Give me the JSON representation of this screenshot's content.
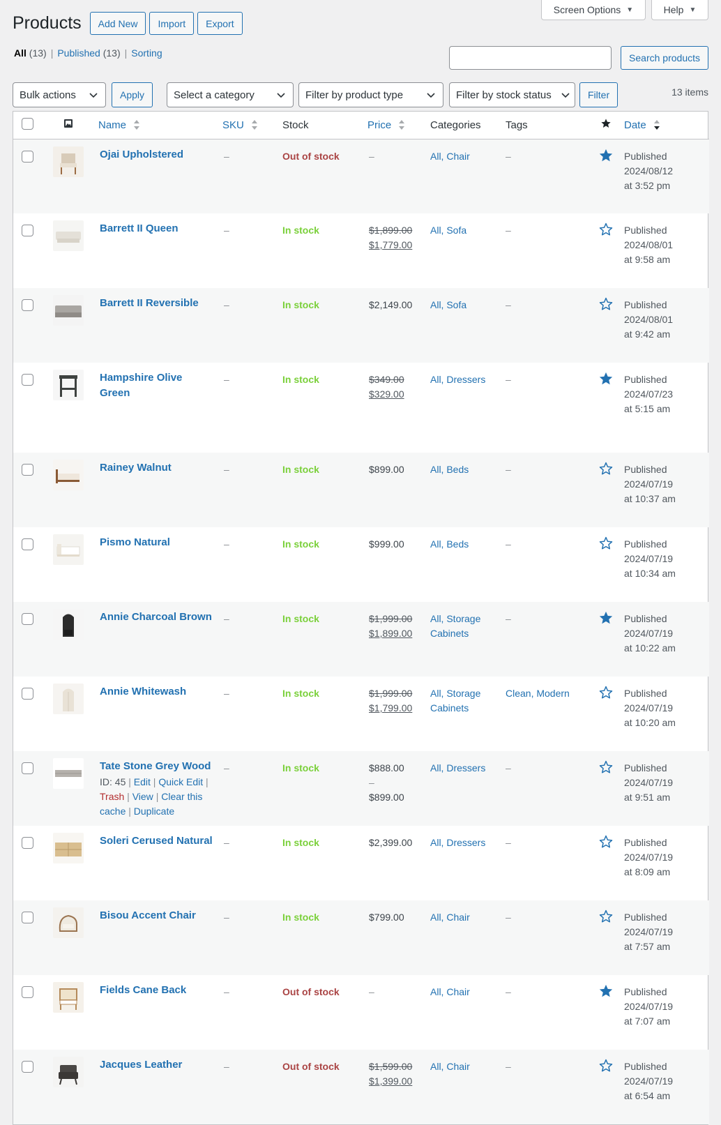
{
  "header": {
    "title": "Products",
    "actions": [
      "Add New",
      "Import",
      "Export"
    ],
    "screen_options": "Screen Options",
    "help": "Help"
  },
  "views": [
    {
      "label": "All",
      "count": "(13)",
      "current": true
    },
    {
      "label": "Published",
      "count": "(13)"
    },
    {
      "label": "Sorting",
      "count": ""
    }
  ],
  "search": {
    "value": "",
    "button": "Search products"
  },
  "tablenav": {
    "bulk_actions": "Bulk actions",
    "apply": "Apply",
    "category": "Select a category",
    "product_type": "Filter by product type",
    "stock_status": "Filter by stock status",
    "filter": "Filter",
    "items": "13 items"
  },
  "columns": {
    "name": "Name",
    "sku": "SKU",
    "stock": "Stock",
    "price": "Price",
    "categories": "Categories",
    "tags": "Tags",
    "date": "Date"
  },
  "colors": {
    "accent": "#2271b1",
    "in_stock": "#7ad03a",
    "out_of_stock": "#aa4444"
  },
  "rows": [
    {
      "name": "Ojai Upholstered",
      "sku": "–",
      "stock": "Out of stock",
      "in": false,
      "price_regular": "–",
      "price_sale": "",
      "categories": "All, Chair",
      "tags": "–",
      "featured": true,
      "status": "Published",
      "date": "2024/08/12",
      "time": "at 3:52 pm",
      "thumb": "chair-light"
    },
    {
      "name": "Barrett II Queen",
      "sku": "–",
      "stock": "In stock",
      "in": true,
      "price_regular": "$1,899.00",
      "price_sale": "$1,779.00",
      "categories": "All, Sofa",
      "tags": "–",
      "featured": false,
      "status": "Published",
      "date": "2024/08/01",
      "time": "at 9:58 am",
      "thumb": "sofa-cream"
    },
    {
      "name": "Barrett II Reversible",
      "sku": "–",
      "stock": "In stock",
      "in": true,
      "price_regular": "$2,149.00",
      "price_sale": "",
      "categories": "All, Sofa",
      "tags": "–",
      "featured": false,
      "status": "Published",
      "date": "2024/08/01",
      "time": "at 9:42 am",
      "thumb": "sofa-grey"
    },
    {
      "name": "Hampshire Olive Green",
      "sku": "–",
      "stock": "In stock",
      "in": true,
      "price_regular": "$349.00",
      "price_sale": "$329.00",
      "categories": "All, Dressers",
      "tags": "–",
      "featured": true,
      "status": "Published",
      "date": "2024/07/23",
      "time": "at 5:15 am",
      "thumb": "table-dark"
    },
    {
      "name": "Rainey Walnut",
      "sku": "–",
      "stock": "In stock",
      "in": true,
      "price_regular": "$899.00",
      "price_sale": "",
      "categories": "All, Beds",
      "tags": "–",
      "featured": false,
      "status": "Published",
      "date": "2024/07/19",
      "time": "at 10:37 am",
      "thumb": "bed-walnut"
    },
    {
      "name": "Pismo Natural",
      "sku": "–",
      "stock": "In stock",
      "in": true,
      "price_regular": "$999.00",
      "price_sale": "",
      "categories": "All, Beds",
      "tags": "–",
      "featured": false,
      "status": "Published",
      "date": "2024/07/19",
      "time": "at 10:34 am",
      "thumb": "bed-white"
    },
    {
      "name": "Annie Charcoal Brown",
      "sku": "–",
      "stock": "In stock",
      "in": true,
      "price_regular": "$1,999.00",
      "price_sale": "$1,899.00",
      "categories": "All, Storage Cabinets",
      "tags": "–",
      "featured": true,
      "status": "Published",
      "date": "2024/07/19",
      "time": "at 10:22 am",
      "thumb": "cabinet-dark"
    },
    {
      "name": "Annie Whitewash",
      "sku": "–",
      "stock": "In stock",
      "in": true,
      "price_regular": "$1,999.00",
      "price_sale": "$1,799.00",
      "categories": "All, Storage Cabinets",
      "tags": "Clean, Modern",
      "featured": false,
      "status": "Published",
      "date": "2024/07/19",
      "time": "at 10:20 am",
      "thumb": "cabinet-light"
    },
    {
      "name": "Tate Stone Grey Wood",
      "sku": "–",
      "stock": "In stock",
      "in": true,
      "price_regular": "$888.00",
      "price_sale": "",
      "price_range_to": "$899.00",
      "categories": "All, Dressers",
      "tags": "–",
      "featured": false,
      "status": "Published",
      "date": "2024/07/19",
      "time": "at 9:51 am",
      "thumb": "dresser-grey",
      "row_actions": {
        "id": "ID: 45",
        "edit": "Edit",
        "quick_edit": "Quick Edit",
        "trash": "Trash",
        "view": "View",
        "clear": "Clear this cache",
        "duplicate": "Duplicate"
      }
    },
    {
      "name": "Soleri Cerused Natural",
      "sku": "–",
      "stock": "In stock",
      "in": true,
      "price_regular": "$2,399.00",
      "price_sale": "",
      "categories": "All, Dressers",
      "tags": "–",
      "featured": false,
      "status": "Published",
      "date": "2024/07/19",
      "time": "at 8:09 am",
      "thumb": "dresser-natural"
    },
    {
      "name": "Bisou Accent Chair",
      "sku": "–",
      "stock": "In stock",
      "in": true,
      "price_regular": "$799.00",
      "price_sale": "",
      "categories": "All, Chair",
      "tags": "–",
      "featured": false,
      "status": "Published",
      "date": "2024/07/19",
      "time": "at 7:57 am",
      "thumb": "chair-cream"
    },
    {
      "name": "Fields Cane Back",
      "sku": "–",
      "stock": "Out of stock",
      "in": false,
      "price_regular": "–",
      "price_sale": "",
      "categories": "All, Chair",
      "tags": "–",
      "featured": true,
      "status": "Published",
      "date": "2024/07/19",
      "time": "at 7:07 am",
      "thumb": "chair-cane"
    },
    {
      "name": "Jacques Leather",
      "sku": "–",
      "stock": "Out of stock",
      "in": false,
      "price_regular": "$1,599.00",
      "price_sale": "$1,399.00",
      "categories": "All, Chair",
      "tags": "–",
      "featured": false,
      "status": "Published",
      "date": "2024/07/19",
      "time": "at 6:54 am",
      "thumb": "chair-leather"
    }
  ]
}
